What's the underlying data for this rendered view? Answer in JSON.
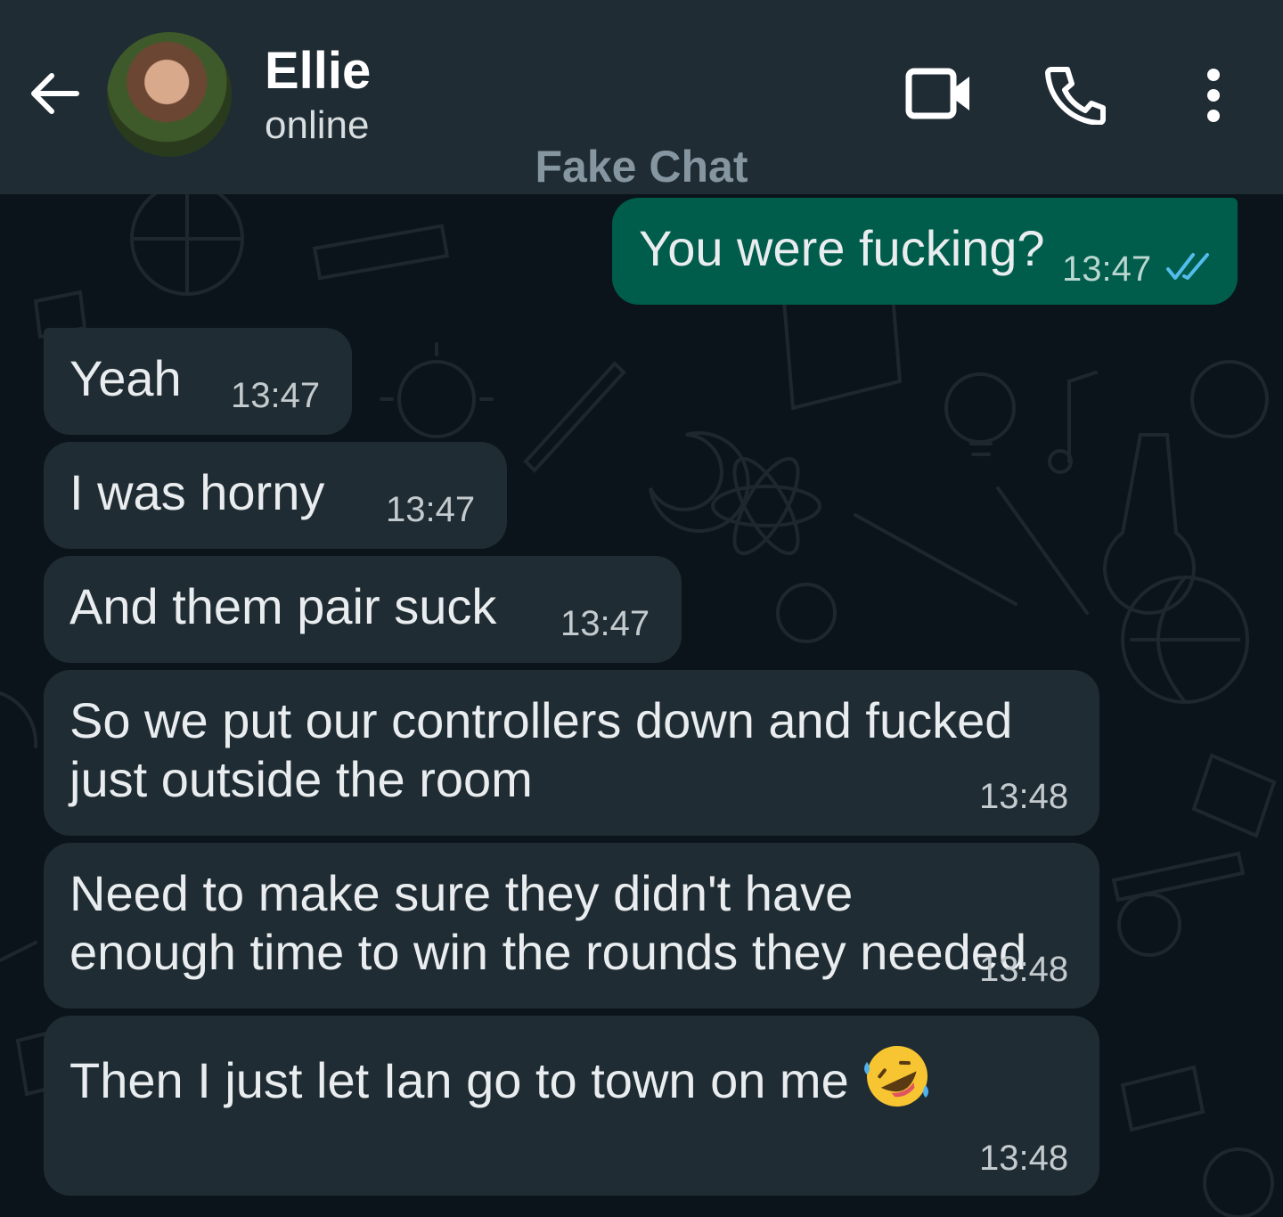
{
  "header": {
    "back_icon": "arrow-left-icon",
    "contact_name": "Ellie",
    "contact_status": "online",
    "watermark": "Fake Chat",
    "video_icon": "video-camera-icon",
    "call_icon": "phone-icon",
    "menu_icon": "more-vertical-icon"
  },
  "colors": {
    "header_bg": "#1f2c34",
    "chat_bg": "#0b141a",
    "incoming_bubble": "#202c33",
    "outgoing_bubble": "#005c4b",
    "read_ticks": "#53bdeb"
  },
  "messages": [
    {
      "direction": "out",
      "text": "You were fucking?",
      "time": "13:47",
      "status": "read"
    },
    {
      "direction": "in",
      "text": "Yeah",
      "time": "13:47"
    },
    {
      "direction": "in",
      "text": "I was horny",
      "time": "13:47"
    },
    {
      "direction": "in",
      "text": "And them pair suck",
      "time": "13:47"
    },
    {
      "direction": "in",
      "text": "So we put our controllers down and fucked just outside the room",
      "time": "13:48"
    },
    {
      "direction": "in",
      "text": "Need to make sure they didn't have enough time to win the rounds they needed",
      "time": "13:48"
    },
    {
      "direction": "in",
      "text": "Then I just let Ian go to town on me",
      "emoji": "rolling-on-the-floor-laughing-emoji",
      "time": "13:48"
    }
  ]
}
